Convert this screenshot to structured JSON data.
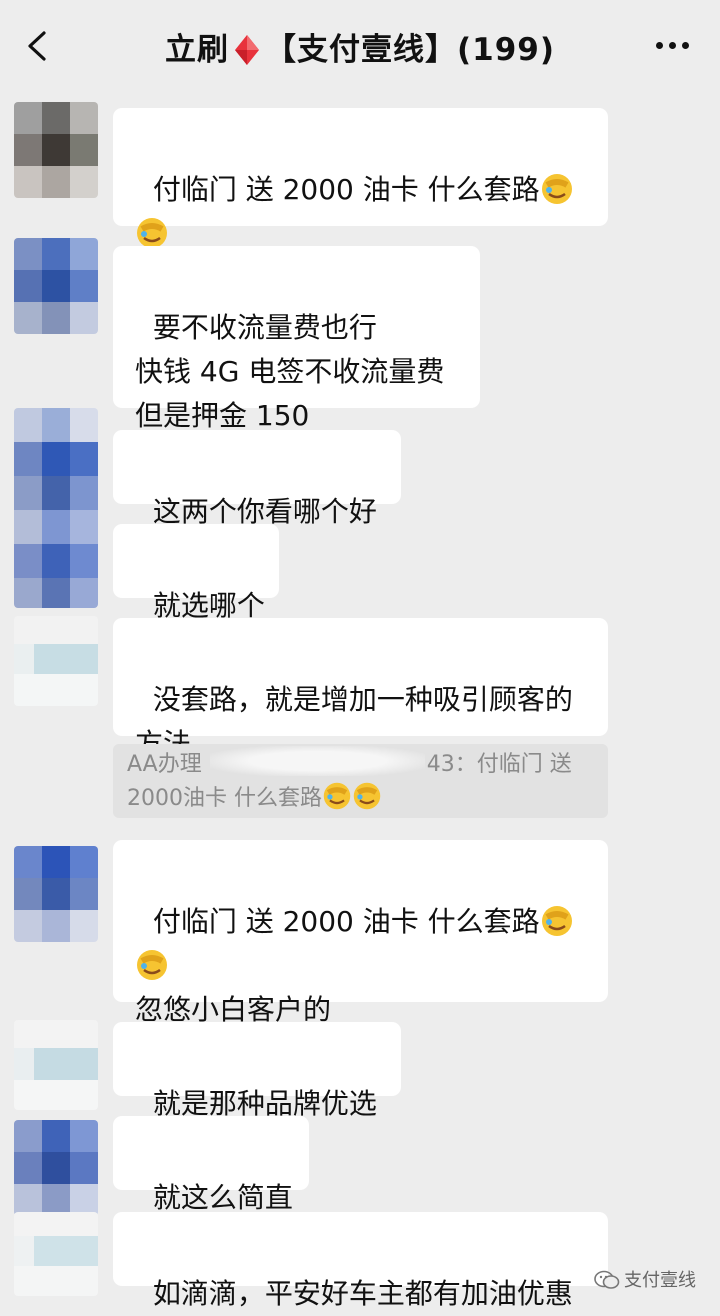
{
  "header": {
    "title_prefix": "立刷",
    "title_suffix": "【支付壹线】(199)",
    "icons": {
      "back": "back-arrow-icon",
      "more": "more-dots-icon",
      "diamond": "red-diamond-icon"
    }
  },
  "messages": [
    {
      "lines": [
        "付临门 送 2000 油卡 什么套路"
      ],
      "emoji_after": [
        "facepalm-emoji"
      ],
      "extra_line_emoji": true
    },
    {
      "lines": [
        "要不收流量费也行",
        "快钱 4G 电签不收流量费",
        "但是押金 150"
      ]
    },
    {
      "lines": [
        "这两个你看哪个好"
      ]
    },
    {
      "lines": [
        "就选哪个"
      ]
    },
    {
      "lines": [
        "没套路，就是增加一种吸引顾客的",
        "方法"
      ]
    },
    {
      "lines": [
        "付临门 送 2000 油卡 什么套路"
      ],
      "extra_line_emoji": true,
      "trailing_line": "忽悠小白客户的"
    },
    {
      "lines": [
        "就是那种品牌优选"
      ]
    },
    {
      "lines": [
        "就这么简直"
      ]
    },
    {
      "lines": [
        "如滴滴，平安好车主都有加油优惠"
      ]
    }
  ],
  "quote": {
    "line1_start": "AA办理",
    "line1_end": "43：付临门 送",
    "line2": "2000油卡 什么套路"
  },
  "watermark": {
    "text": "支付壹线",
    "icon": "wechat-icon"
  },
  "colors": {
    "background": "#ededed",
    "bubble": "#ffffff",
    "quote_bg": "#e2e2e2",
    "quote_text": "#8a8a8a",
    "diamond": "#e8323c"
  }
}
